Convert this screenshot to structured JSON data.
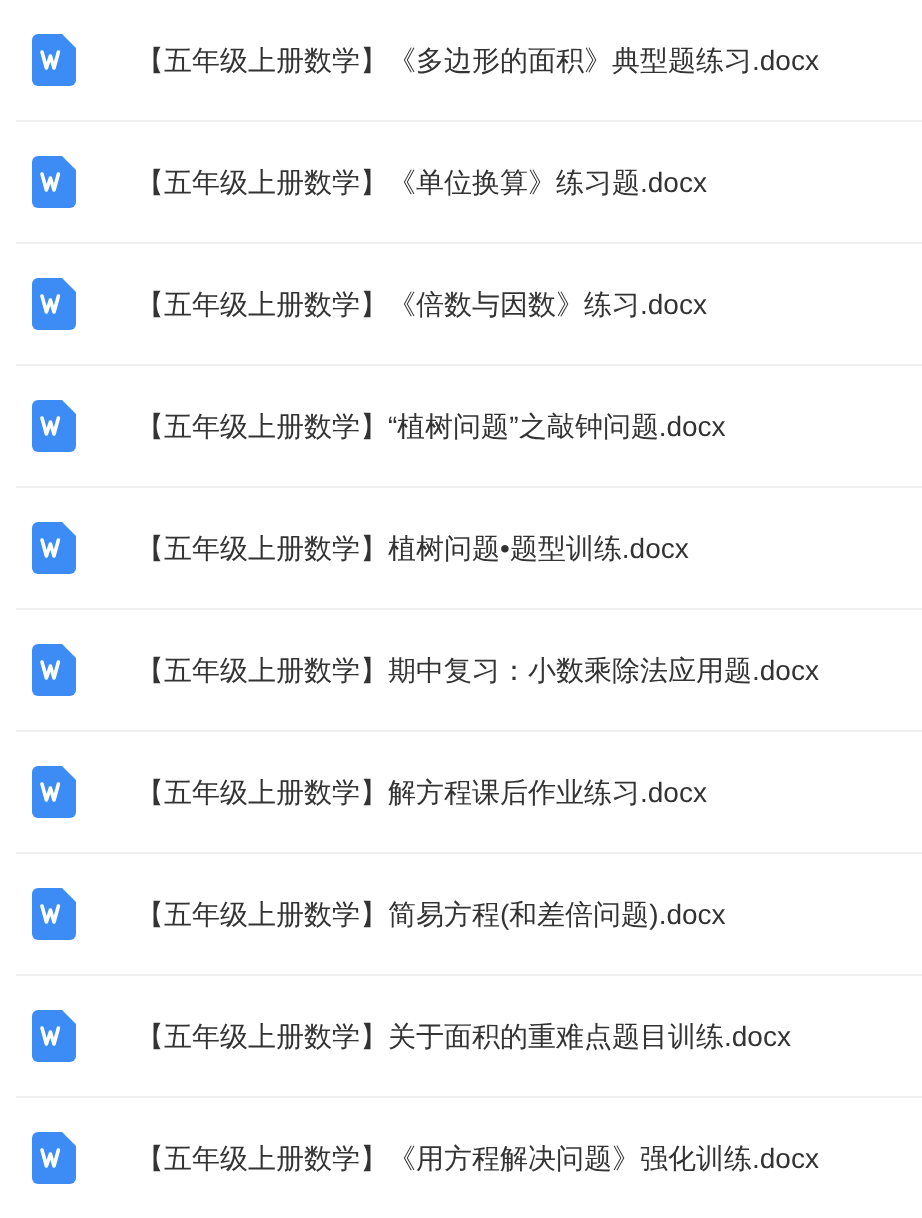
{
  "files": [
    {
      "name": "【五年级上册数学】《多边形的面积》典型题练习.docx"
    },
    {
      "name": "【五年级上册数学】《单位换算》练习题.docx"
    },
    {
      "name": "【五年级上册数学】《倍数与因数》练习.docx"
    },
    {
      "name": "【五年级上册数学】“植树问题”之敲钟问题.docx"
    },
    {
      "name": "【五年级上册数学】植树问题•题型训练.docx"
    },
    {
      "name": "【五年级上册数学】期中复习：小数乘除法应用题.docx"
    },
    {
      "name": "【五年级上册数学】解方程课后作业练习.docx"
    },
    {
      "name": "【五年级上册数学】简易方程(和差倍问题).docx"
    },
    {
      "name": "【五年级上册数学】关于面积的重难点题目训练.docx"
    },
    {
      "name": "【五年级上册数学】《用方程解决问题》强化训练.docx"
    }
  ]
}
